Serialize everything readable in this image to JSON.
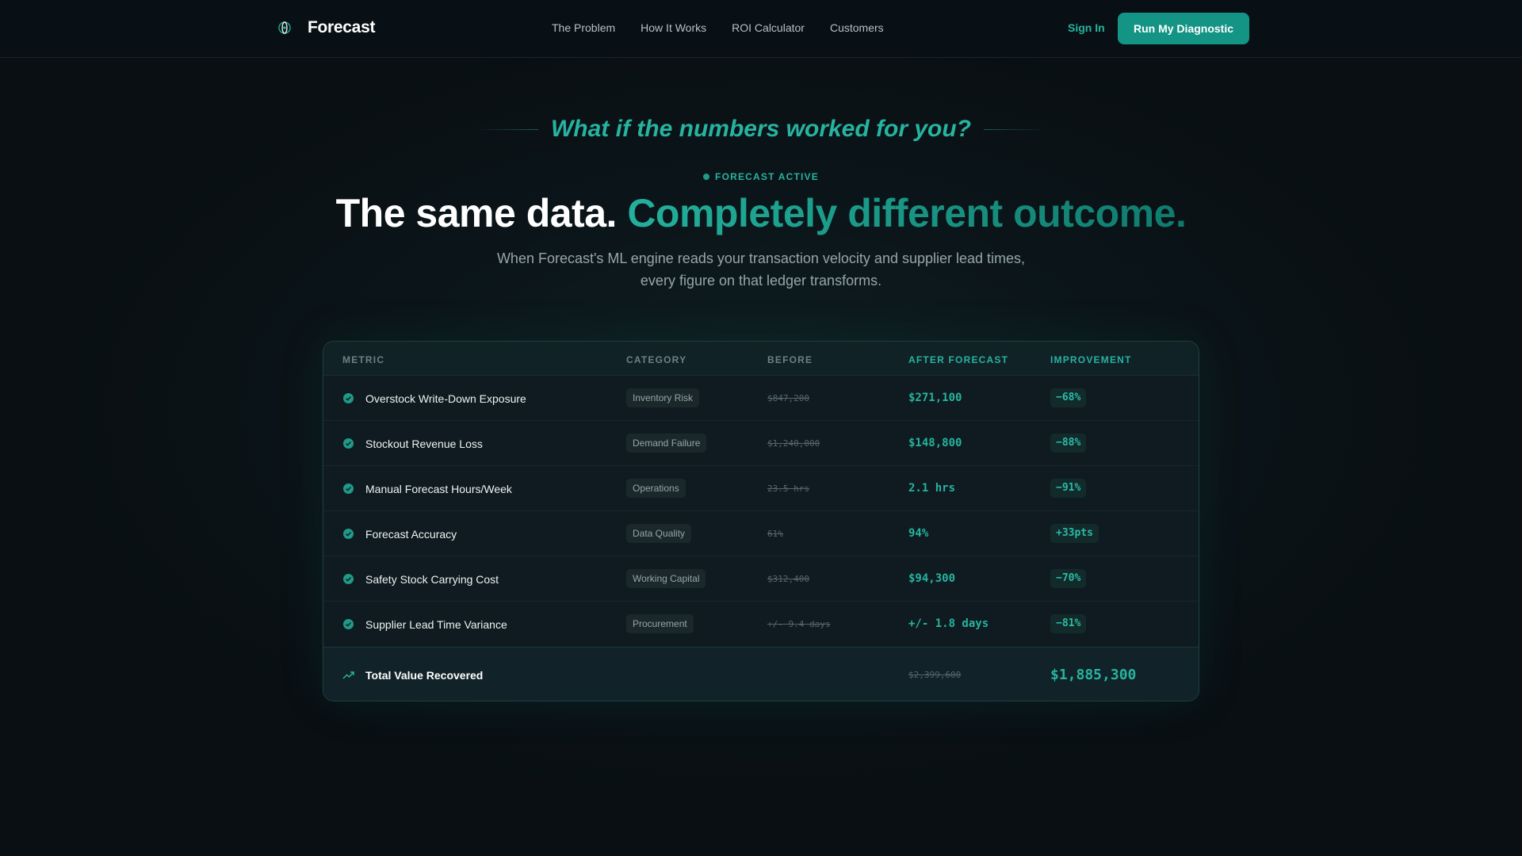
{
  "brand": {
    "name": "Forecast",
    "icon": "atom-globe-icon"
  },
  "nav": {
    "links": [
      "The Problem",
      "How It Works",
      "ROI Calculator",
      "Customers"
    ],
    "sign_in": "Sign In",
    "cta": "Run My Diagnostic"
  },
  "hero": {
    "tagline": "What if the numbers worked for you?",
    "status": "FORECAST ACTIVE",
    "headline_white": "The same data.",
    "headline_accent": "Completely different outcome.",
    "subtitle_line1": "When Forecast's ML engine reads your transaction velocity and supplier lead times,",
    "subtitle_line2": "every figure on that ledger transforms."
  },
  "table": {
    "headers": [
      "METRIC",
      "CATEGORY",
      "BEFORE",
      "AFTER FORECAST",
      "IMPROVEMENT"
    ],
    "rows": [
      {
        "metric": "Overstock Write-Down Exposure",
        "category": "Inventory Risk",
        "before": "$847,200",
        "after": "$271,100",
        "improvement": "−68%"
      },
      {
        "metric": "Stockout Revenue Loss",
        "category": "Demand Failure",
        "before": "$1,240,000",
        "after": "$148,800",
        "improvement": "−88%"
      },
      {
        "metric": "Manual Forecast Hours/Week",
        "category": "Operations",
        "before": "23.5 hrs",
        "after": "2.1 hrs",
        "improvement": "−91%"
      },
      {
        "metric": "Forecast Accuracy",
        "category": "Data Quality",
        "before": "61%",
        "after": "94%",
        "improvement": "+33pts"
      },
      {
        "metric": "Safety Stock Carrying Cost",
        "category": "Working Capital",
        "before": "$312,400",
        "after": "$94,300",
        "improvement": "−70%"
      },
      {
        "metric": "Supplier Lead Time Variance",
        "category": "Procurement",
        "before": "+/- 9.4 days",
        "after": "+/- 1.8 days",
        "improvement": "−81%"
      }
    ],
    "total": {
      "label": "Total Value Recovered",
      "before": "$2,399,600",
      "after": "$1,885,300",
      "icon": "trending-up-icon"
    }
  },
  "colors": {
    "accent": "#27b3a0",
    "cta_bg": "#139484",
    "background": "#0b1519"
  }
}
